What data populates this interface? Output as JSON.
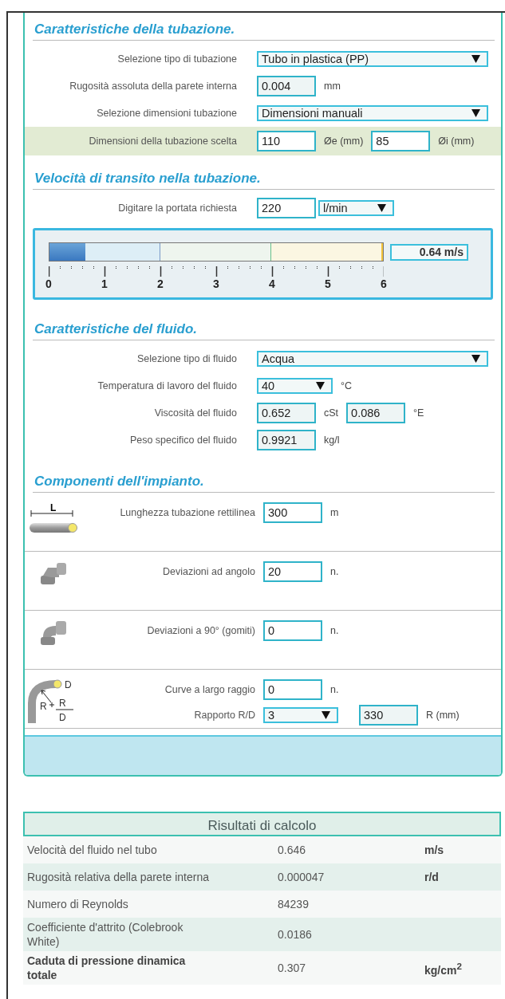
{
  "pipe": {
    "title": "Caratteristiche della tubazione.",
    "rows": [
      {
        "label": "Selezione tipo di tubazione",
        "highlighted": false,
        "fields": [
          {
            "kind": "select",
            "value": "Tubo in plastica (PP)"
          }
        ]
      },
      {
        "label": "Rugosità assoluta della parete interna",
        "highlighted": false,
        "fields": [
          {
            "kind": "input",
            "value": "0.004",
            "readonly": true,
            "unit": "mm"
          }
        ]
      },
      {
        "label": "Selezione dimensioni tubazione",
        "highlighted": false,
        "fields": [
          {
            "kind": "select",
            "value": "Dimensioni manuali"
          }
        ]
      },
      {
        "label": "Dimensioni della tubazione scelta",
        "highlighted": true,
        "fields": [
          {
            "kind": "input",
            "value": "110",
            "readonly": false,
            "unit": "Øe (mm)"
          },
          {
            "kind": "input",
            "value": "85",
            "readonly": false,
            "unit": "Øi (mm)"
          }
        ]
      }
    ]
  },
  "velocity": {
    "title": "Velocità di transito nella tubazione.",
    "rows": [
      {
        "label": "Digitare la portata richiesta",
        "highlighted": false,
        "fields": [
          {
            "kind": "input",
            "value": "220",
            "readonly": false
          },
          {
            "kind": "select",
            "value": "l/min"
          }
        ]
      }
    ],
    "gauge": {
      "level": 0.107,
      "reading": "0.64 m/s",
      "scale": [
        "0",
        "1",
        "2",
        "3",
        "4",
        "5",
        "6"
      ]
    }
  },
  "fluid": {
    "title": "Caratteristiche del fluido.",
    "rows": [
      {
        "label": "Selezione tipo di fluido",
        "highlighted": false,
        "fields": [
          {
            "kind": "select",
            "value": "Acqua"
          }
        ]
      },
      {
        "label": "Temperatura di lavoro del fluido",
        "highlighted": false,
        "fields": [
          {
            "kind": "select",
            "value": "40",
            "unit": "°C"
          }
        ]
      },
      {
        "label": "Viscosità del fluido",
        "highlighted": false,
        "fields": [
          {
            "kind": "input",
            "value": "0.652",
            "readonly": true,
            "unit": "cSt"
          },
          {
            "kind": "input",
            "value": "0.086",
            "readonly": true,
            "unit": "°E"
          }
        ]
      },
      {
        "label": "Peso specifico del fluido",
        "highlighted": false,
        "fields": [
          {
            "kind": "input",
            "value": "0.9921",
            "readonly": true,
            "unit": "kg/l"
          }
        ]
      }
    ]
  },
  "components": {
    "title": "Componenti dell'impianto.",
    "items": [
      {
        "kind": "straight",
        "icon_text": [
          "L"
        ],
        "lines": [
          {
            "label": "Lunghezza tubazione rettilinea",
            "fields": [
              {
                "kind": "input",
                "value": "300",
                "readonly": false,
                "unit": "m"
              }
            ]
          }
        ]
      },
      {
        "kind": "angle",
        "lines": [
          {
            "label": "Deviazioni ad angolo",
            "fields": [
              {
                "kind": "input",
                "value": "20",
                "readonly": false,
                "unit": "n."
              }
            ]
          }
        ]
      },
      {
        "kind": "elbow",
        "lines": [
          {
            "label": "Deviazioni a 90° (gomiti)",
            "fields": [
              {
                "kind": "input",
                "value": "0",
                "readonly": false,
                "unit": "n."
              }
            ]
          }
        ]
      },
      {
        "kind": "bend",
        "icon_text": [
          "D",
          "R",
          "R",
          "D"
        ],
        "lines": [
          {
            "label": "Curve a largo raggio",
            "fields": [
              {
                "kind": "input",
                "value": "0",
                "readonly": false,
                "unit": "n."
              }
            ]
          },
          {
            "label": "Rapporto R/D",
            "fields": [
              {
                "kind": "select",
                "value": "3"
              },
              {
                "kind": "input",
                "value": "330",
                "readonly": true,
                "unit": "R (mm)"
              }
            ]
          }
        ]
      }
    ]
  },
  "results": {
    "title": "Risultati di calcolo",
    "rows": [
      {
        "label": "Velocità del fluido nel tubo",
        "value": "0.646",
        "unit": "m/s",
        "emphasis": false
      },
      {
        "label": "Rugosità relativa della parete interna",
        "value": "0.000047",
        "unit": "r/d",
        "emphasis": false
      },
      {
        "label": "Numero di Reynolds",
        "value": "84239",
        "emphasis": false
      },
      {
        "label": "Coefficiente d'attrito (Colebrook White)",
        "value": "0.0186",
        "emphasis": false
      },
      {
        "label": "Caduta di pressione dinamica totale",
        "value": "0.307",
        "unit": "kg/cm$^{2}$",
        "emphasis": true
      }
    ]
  }
}
